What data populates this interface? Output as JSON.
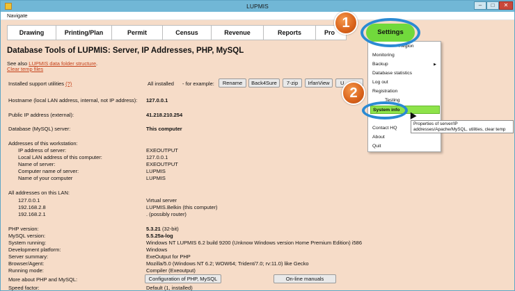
{
  "window": {
    "title": "LUPMIS",
    "minimize": "–",
    "maximize": "□",
    "close": "✕"
  },
  "menubar": {
    "navigate": "Navigate"
  },
  "tabs": [
    "Drawing",
    "Printing/Plan",
    "Permit",
    "Census",
    "Revenue",
    "Reports",
    "Pro",
    "Settings"
  ],
  "page": {
    "title": "Database Tools of LUPMIS: Server, IP Addresses, PHP, MySQL",
    "see_also": "See also",
    "see_also_link": "LUPMIS data folder structure",
    "see_also_period": ".",
    "clear_temp": "Clear temp files"
  },
  "utilities": {
    "label": "Installed support utilities",
    "help": "(?)",
    "status": "All installed",
    "example": "- for example:",
    "buttons": [
      "Rename",
      "Back4Sure",
      "7-zip",
      "IrfanView",
      "U"
    ]
  },
  "rows": {
    "hostname_label": "Hostname (local LAN address, internal, not IP address):",
    "hostname_value": "127.0.0.1",
    "public_ip_label": "Public IP address (external):",
    "public_ip_value": "41.218.210.254",
    "db_label": "Database (MySQL) server:",
    "db_value": "This computer",
    "workstation_header": "Addresses of this workstation:",
    "ws_server_ip_label": "IP address of server:",
    "ws_server_ip_value": "EXEOUTPUT",
    "ws_local_lan_label": "Local LAN address of this computer:",
    "ws_local_lan_value": "127.0.0.1",
    "ws_server_name_label": "Name of server:",
    "ws_server_name_value": "EXEOUTPUT",
    "ws_computer_name_label": "Computer name of server:",
    "ws_computer_name_value": "LUPMIS",
    "ws_your_name_label": "Name of your computer",
    "ws_your_name_value": "LUPMIS",
    "lan_header": "All addresses on this LAN:",
    "lan_1_ip": "127.0.0.1",
    "lan_1_desc": "Virtual server",
    "lan_2_ip": "192.168.2.8",
    "lan_2_desc": "LUPMIS.Belkin (this computer)",
    "lan_3_ip": "192.168.2.1",
    "lan_3_desc": ". (possibly router)",
    "php_label": "PHP version:",
    "php_value": "5.3.21",
    "php_suffix": "(32-bit)",
    "mysql_label": "MySQL version:",
    "mysql_value": "5.5.25a-log",
    "system_label": "System running:",
    "system_value": "Windows NT LUPMIS 6.2 build 9200 (Unknow Windows version Home Premium Edition) i586",
    "dev_label": "Development platform:",
    "dev_value": "Windows",
    "server_summary_label": "Server summary:",
    "server_summary_value": "ExeOutput for PHP",
    "browser_label": "Browser/Agent:",
    "browser_value": "Mozilla/5.0 (Windows NT 6.2; WOW64; Trident/7.0; rv:11.0) like Gecko",
    "running_label": "Running mode:",
    "running_value": "Compiler (Exeoutput)",
    "more_label": "More about PHP and MySQL:",
    "config_button": "Configuration of PHP, MySQL",
    "online_button": "On-line manuals",
    "speed_label": "Speed factor:",
    "speed_value": "Default (1, installed)"
  },
  "settings_menu": {
    "items": [
      "Region",
      "Monitoring",
      "Backup",
      "Database statistics",
      "Log out",
      "Registration",
      "Testing",
      "System info",
      "Contact HQ",
      "About",
      "Quit"
    ],
    "tooltip": "Properties of server/IP addresses/Apache/MySQL, utilities, clear temp"
  },
  "callouts": {
    "one": "1",
    "two": "2"
  },
  "colors": {
    "highlight": "#8ee34a",
    "callout": "#d9621a",
    "ring": "#2b8ad3",
    "link": "#c4411a",
    "background": "#f6dcc8"
  }
}
